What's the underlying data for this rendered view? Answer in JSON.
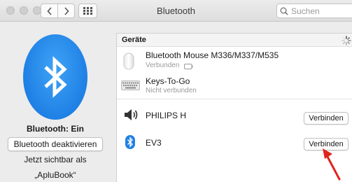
{
  "window": {
    "title": "Bluetooth"
  },
  "search": {
    "placeholder": "Suchen"
  },
  "left": {
    "status": "Bluetooth: Ein",
    "toggle_button": "Bluetooth deaktivieren",
    "visible_text": "Jetzt sichtbar als",
    "device_name": "„ApluBook“"
  },
  "list": {
    "header": "Geräte",
    "paired": [
      {
        "name": "Bluetooth Mouse M336/M337/M535",
        "status": "Verbunden",
        "icon": "mouse-icon"
      },
      {
        "name": "Keys-To-Go",
        "status": "Nicht verbunden",
        "icon": "keyboard-icon"
      }
    ],
    "nearby": [
      {
        "name": "PHILIPS H",
        "button": "Verbinden",
        "icon": "speaker-icon"
      },
      {
        "name": "EV3",
        "button": "Verbinden",
        "icon": "bluetooth-icon"
      }
    ]
  },
  "colors": {
    "accent": "#1f80e5",
    "annotation_arrow": "#e0241b"
  }
}
